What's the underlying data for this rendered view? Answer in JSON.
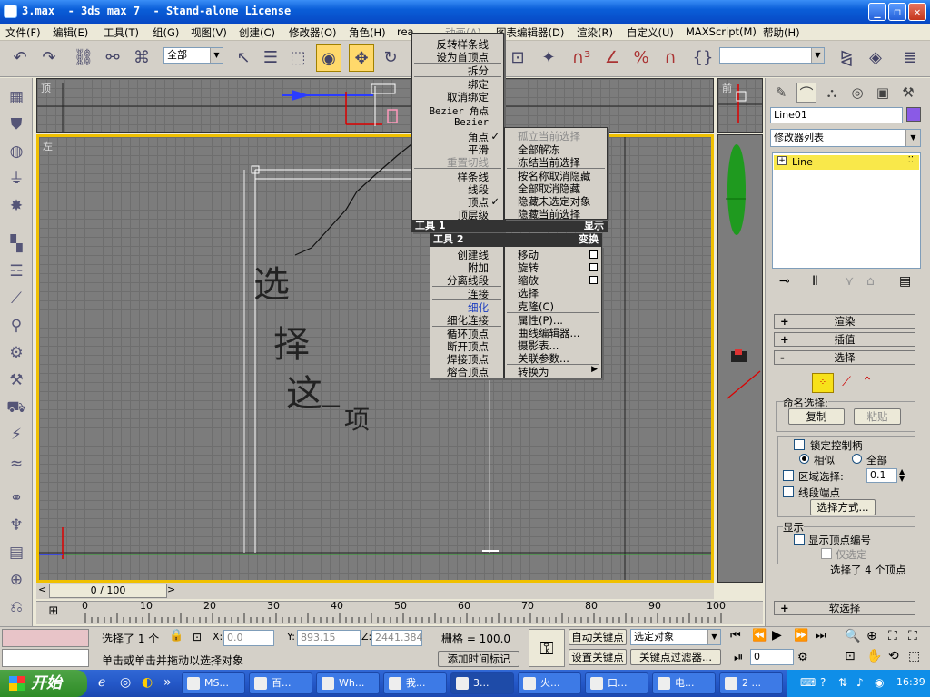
{
  "window": {
    "title": "3.max  - 3ds max 7  - Stand-alone License"
  },
  "menubar": [
    "文件(F)",
    "编辑(E)",
    "工具(T)",
    "组(G)",
    "视图(V)",
    "创建(C)",
    "修改器(O)",
    "角色(H)",
    "rea",
    "动画(A)",
    "图表编辑器(D)",
    "渲染(R)",
    "自定义(U)",
    "MAXScript(M)",
    "帮助(H)"
  ],
  "toolbar": {
    "selection_filter": "全部"
  },
  "viewports": {
    "top_label": "顶",
    "front_label": "前",
    "left_label": "左"
  },
  "annotation": {
    "chars": [
      "选",
      "择",
      "这",
      "一",
      "项"
    ]
  },
  "quad_menu": {
    "top_left": {
      "items": [
        {
          "label": "反转样条线",
          "state": ""
        },
        {
          "label": "设为首顶点",
          "state": ""
        },
        {
          "label": "拆分",
          "state": ""
        },
        {
          "label": "绑定",
          "state": ""
        },
        {
          "label": "取消绑定",
          "state": ""
        },
        {
          "label": "Bezier 角点",
          "state": ""
        },
        {
          "label": "Bezier",
          "state": ""
        },
        {
          "label": "角点",
          "state": "checked"
        },
        {
          "label": "平滑",
          "state": ""
        },
        {
          "label": "重置切线",
          "state": "disabled"
        },
        {
          "label": "样条线",
          "state": ""
        },
        {
          "label": "线段",
          "state": ""
        },
        {
          "label": "顶点",
          "state": "checked"
        },
        {
          "label": "顶层级",
          "state": ""
        }
      ],
      "header_left": "工具 1",
      "header_right": "显示",
      "check": "✓"
    },
    "top_right": {
      "items": [
        {
          "label": "孤立当前选择",
          "state": "disabled"
        },
        {
          "label": "全部解冻",
          "state": ""
        },
        {
          "label": "冻结当前选择",
          "state": ""
        },
        {
          "label": "按名称取消隐藏",
          "state": ""
        },
        {
          "label": "全部取消隐藏",
          "state": ""
        },
        {
          "label": "隐藏未选定对象",
          "state": ""
        },
        {
          "label": "隐藏当前选择",
          "state": ""
        }
      ]
    },
    "bottom_left": {
      "header_left": "工具 2",
      "header_right": "变换",
      "items": [
        {
          "label": "创建线",
          "state": ""
        },
        {
          "label": "附加",
          "state": ""
        },
        {
          "label": "分离线段",
          "state": ""
        },
        {
          "label": "连接",
          "state": ""
        },
        {
          "label": "细化",
          "state": "highlight"
        },
        {
          "label": "细化连接",
          "state": ""
        },
        {
          "label": "循环顶点",
          "state": ""
        },
        {
          "label": "断开顶点",
          "state": ""
        },
        {
          "label": "焊接顶点",
          "state": ""
        },
        {
          "label": "熔合顶点",
          "state": ""
        }
      ]
    },
    "bottom_right": {
      "items": [
        {
          "label": "移动",
          "box": true
        },
        {
          "label": "旋转",
          "box": true
        },
        {
          "label": "缩放",
          "box": true
        },
        {
          "label": "选择",
          "box": false
        },
        {
          "label": "克隆(C)",
          "box": false
        },
        {
          "label": "属性(P)...",
          "box": false
        },
        {
          "label": "曲线编辑器...",
          "box": false
        },
        {
          "label": "摄影表...",
          "box": false
        },
        {
          "label": "关联参数...",
          "box": false
        },
        {
          "label": "转换为",
          "box": false
        }
      ],
      "submenu_arrow": "▶"
    }
  },
  "command_panel": {
    "object_name": "Line01",
    "object_color": "#8a5ae6",
    "modifier_list": "修改器列表",
    "stack_item": "Line",
    "rollouts": {
      "render": "渲染",
      "interp": "插值",
      "select": "选择",
      "soft": "软选择"
    },
    "named_sel": {
      "label": "命名选择:",
      "copy": "复制",
      "paste": "粘贴"
    },
    "lock_handles": "锁定控制柄",
    "alike": "相似",
    "all": "全部",
    "area_sel": "区域选择:",
    "area_value": "0.1",
    "seg_end": "线段端点",
    "select_by": "选择方式...",
    "display_label": "显示",
    "show_vert": "显示顶点编号",
    "only_sel": "仅选定",
    "status": "选择了 4 个顶点"
  },
  "timeline": {
    "frame": "0 / 100",
    "ticks": [
      "0",
      "10",
      "20",
      "30",
      "40",
      "50",
      "60",
      "70",
      "80",
      "90",
      "100"
    ]
  },
  "status": {
    "selected": "选择了 1 个",
    "x_label": "X:",
    "x_value": "0.0",
    "y_label": "Y:",
    "y_value": "893.15",
    "z_label": "Z:",
    "z_value": "2441.384",
    "grid": "栅格 = 100.0",
    "prompt": "单击或单击并拖动以选择对象",
    "add_time_tag": "添加时间标记",
    "auto_key": "自动关键点",
    "set_key": "设置关键点",
    "key_mode": "选定对象",
    "key_filters": "关键点过滤器...",
    "frame_value": "0"
  },
  "taskbar": {
    "start": "开始",
    "tasks": [
      "MS...",
      "百...",
      "Wh...",
      "我...",
      "3...",
      "火...",
      "口...",
      "电...",
      "2 ..."
    ],
    "clock": "16:39"
  }
}
